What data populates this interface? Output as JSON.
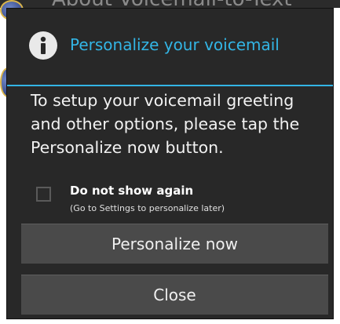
{
  "background": {
    "title": "About Voicemail-to-Text"
  },
  "dialog": {
    "title": "Personalize your voicemail",
    "message": "To setup your voicemail greeting and other options, please tap the Personalize now button.",
    "checkbox": {
      "label": "Do not show again",
      "sublabel": "(Go to Settings to personalize later)",
      "checked": false
    },
    "buttons": {
      "personalize_label": "Personalize now",
      "close_label": "Close"
    },
    "icon": "info-icon"
  },
  "colors": {
    "accent": "#33b5e5",
    "dialog_bg": "#282828",
    "button_bg": "#4a4a4a"
  }
}
